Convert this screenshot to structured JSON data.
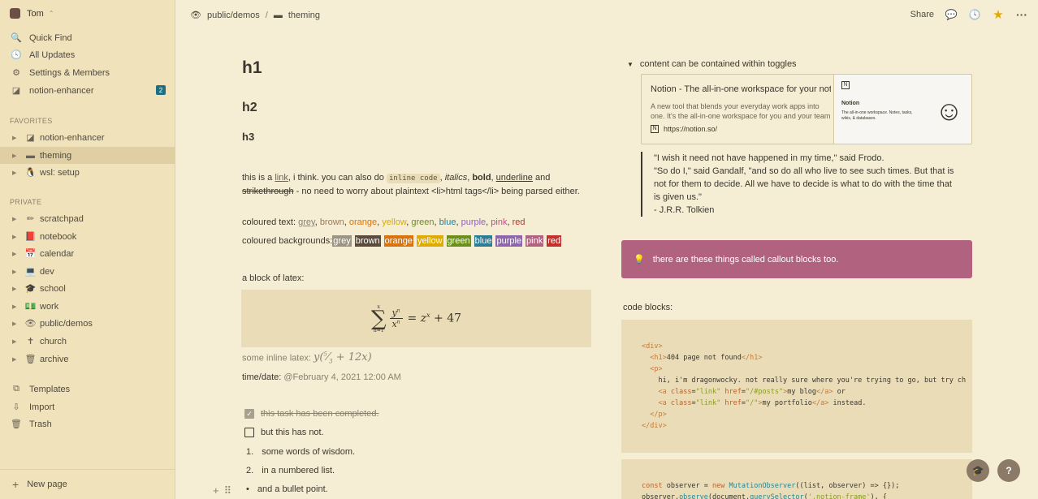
{
  "workspace": {
    "name": "Tom"
  },
  "nav": [
    {
      "label": "Quick Find",
      "icon": "search-icon",
      "glyph": "🔍"
    },
    {
      "label": "All Updates",
      "icon": "clock-icon",
      "glyph": "🕓"
    },
    {
      "label": "Settings & Members",
      "icon": "gear-icon",
      "glyph": "⚙"
    },
    {
      "label": "notion-enhancer",
      "icon": "enhancer-icon",
      "glyph": "◪",
      "badge": "2"
    }
  ],
  "favorites_title": "FAVORITES",
  "favorites": [
    {
      "label": "notion-enhancer",
      "glyph": "◪"
    },
    {
      "label": "theming",
      "glyph": "▬"
    },
    {
      "label": "wsl: setup",
      "glyph": "🐧"
    }
  ],
  "private_title": "PRIVATE",
  "private": [
    {
      "label": "scratchpad",
      "glyph": "✏"
    },
    {
      "label": "notebook",
      "glyph": "📕"
    },
    {
      "label": "calendar",
      "glyph": "📅"
    },
    {
      "label": "dev",
      "glyph": "💻"
    },
    {
      "label": "school",
      "glyph": "🎓"
    },
    {
      "label": "work",
      "glyph": "💵"
    },
    {
      "label": "public/demos",
      "glyph": "👁"
    },
    {
      "label": "church",
      "glyph": "✝"
    },
    {
      "label": "archive",
      "glyph": "🗑"
    }
  ],
  "bottom": [
    {
      "label": "Templates",
      "glyph": "⧉"
    },
    {
      "label": "Import",
      "glyph": "⇩"
    },
    {
      "label": "Trash",
      "glyph": "🗑"
    }
  ],
  "new_page": "New page",
  "breadcrumb": {
    "parent": "public/demos",
    "sep": "/",
    "current": "theming"
  },
  "topbar": {
    "share": "Share"
  },
  "content": {
    "h1": "h1",
    "h2": "h2",
    "h3": "h3",
    "p1_a": "this is a ",
    "p1_link": "link",
    "p1_b": ", i think. you can also do ",
    "p1_code": "inline code",
    "p1_c": ", ",
    "p1_italic": "italics",
    "p1_d": ", ",
    "p1_bold": "bold",
    "p1_e": ", ",
    "p1_underline": "underline",
    "p1_f": " and ",
    "p1_strike": "strikethrough",
    "p1_g": " - no need to worry about plaintext <li>html tags</li> being parsed either.",
    "coloured_text_label": "coloured text: ",
    "coloured_text": [
      {
        "t": "grey",
        "c": "#8a8170"
      },
      {
        "t": "brown",
        "c": "#9a7b5a"
      },
      {
        "t": "orange",
        "c": "#d9730d"
      },
      {
        "t": "yellow",
        "c": "#dfab01"
      },
      {
        "t": "green",
        "c": "#6a8f1a"
      },
      {
        "t": "blue",
        "c": "#2a7d95"
      },
      {
        "t": "purple",
        "c": "#9065b0"
      },
      {
        "t": "pink",
        "c": "#c14c8a"
      },
      {
        "t": "red",
        "c": "#c4302b"
      }
    ],
    "coloured_bg_label": "coloured backgrounds: ",
    "coloured_bg": [
      {
        "t": "grey",
        "c": "#9b9383"
      },
      {
        "t": "brown",
        "c": "#5c4a3a"
      },
      {
        "t": "orange",
        "c": "#d9730d"
      },
      {
        "t": "yellow",
        "c": "#dfab01"
      },
      {
        "t": "green",
        "c": "#6a8f1a"
      },
      {
        "t": "blue",
        "c": "#2a7d95"
      },
      {
        "t": "purple",
        "c": "#9065b0"
      },
      {
        "t": "pink",
        "c": "#b0627e"
      },
      {
        "t": "red",
        "c": "#c4302b"
      }
    ],
    "latex_label": "a block of latex:",
    "inline_latex_label": "some inline latex: ",
    "time_label": "time/date: ",
    "time_value": "@February 4, 2021 12:00 AM",
    "todo_done": "this task has been completed.",
    "todo_open": "but this has not.",
    "numbered": [
      "some words of wisdom.",
      "in a numbered list."
    ],
    "bullet": "and a bullet point.",
    "toggle": "content can be contained within toggles",
    "bookmark": {
      "title": "Notion - The all-in-one workspace for your notes, tasks, wikis, and databases.",
      "desc": "A new tool that blends your everyday work apps into one. It's the all-in-one workspace for you and your team",
      "url": "https://notion.so/",
      "thumb_title": "Notion",
      "thumb_desc": "The all-in-one workspace. Notes, tasks, wikis, & databases."
    },
    "quote": [
      "\"I wish it need not have happened in my time,\" said Frodo.",
      "\"So do I,\" said Gandalf, \"and so do all who live to see such times. But that is not for them to decide. All we have to decide is what to do with the time that is given us.\"",
      "- J.R.R. Tolkien"
    ],
    "callout": "there are these things called callout blocks too.",
    "code_label": "code blocks:"
  },
  "colors": {
    "sidebar": "#f0e2bb",
    "page": "#f5edd4",
    "callout": "#b0627e",
    "badge": "#1f6f83"
  }
}
